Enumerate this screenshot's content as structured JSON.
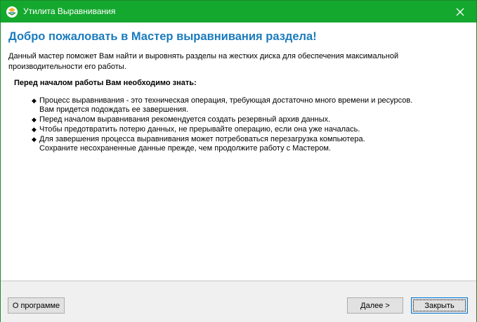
{
  "window": {
    "title": "Утилита Выравнивания",
    "colors": {
      "titlebar": "#15a82f",
      "heading": "#1a7bbd",
      "footer": "#f0f0f0"
    }
  },
  "content": {
    "heading": "Добро пожаловать в Мастер выравнивания раздела!",
    "intro": "Данный мастер поможет Вам найти и выровнять разделы на жестких диска для обеспечения максимальной производительности его работы.",
    "subheading": "Перед началом работы Вам необходимо знать:",
    "bullets": [
      {
        "line1": "Процесс выравнивания - это техническая операция, требующая достаточно много времени и ресурсов.",
        "line2": "Вам придется подождать ее завершения."
      },
      {
        "line1": "Перед началом выравнивания рекомендуется создать резервный архив данных.",
        "line2": ""
      },
      {
        "line1": "Чтобы предотвратить потерю данных, не прерывайте операцию, если она уже началась.",
        "line2": ""
      },
      {
        "line1": "Для завершения процесса выравнивания может потребоваться перезагрузка компьютера.",
        "line2": "Сохраните несохраненные данные прежде, чем продолжите работу с Мастером."
      }
    ]
  },
  "footer": {
    "about_label": "О программе",
    "next_label": "Далее >",
    "close_label": "Закрыть"
  },
  "icons": {
    "app": "app-logo-icon",
    "close": "close-icon",
    "bullet": "bullet-icon"
  }
}
